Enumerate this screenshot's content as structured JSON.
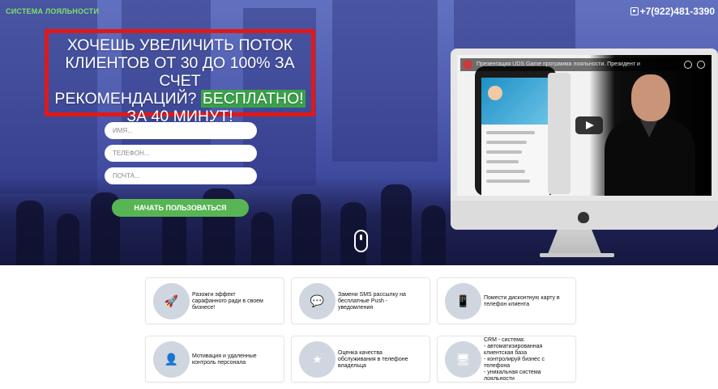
{
  "header": {
    "brand": "СИСТЕМА ЛОЯЛЬНОСТИ",
    "phone": "+7(922)481-3390"
  },
  "hero": {
    "headline_lines": [
      "ХОЧЕШЬ УВЕЛИЧИТЬ ПОТОК",
      "КЛИЕНТОВ ОТ 30 ДО 100% ЗА СЧЕТ",
      "РЕКОМЕНДАЦИЙ?"
    ],
    "headline_free": "БЕСПЛАТНО!",
    "headline_last": "ЗА 40 МИНУТ!",
    "form": {
      "name_placeholder": "ИМЯ...",
      "phone_placeholder": "ТЕЛЕФОН...",
      "email_placeholder": "ПОЧТА...",
      "submit_label": "НАЧАТЬ ПОЛЬЗОВАТЬСЯ"
    }
  },
  "video": {
    "title": "Презентация UDS Game программа лояльности. Президент и"
  },
  "features": [
    {
      "icon": "rocket-icon",
      "text": "Разожги эффект\nсарафанного ради в своем\nбизнесе!"
    },
    {
      "icon": "chat-bubble-icon",
      "text": "Замени SMS рассылку на\nбесплатные Push -\nуведомления"
    },
    {
      "icon": "mobile-cart-icon",
      "text": "Помести дисконтную карту в\nтелефон клиента"
    },
    {
      "icon": "staff-icon",
      "text": "Мотивация и удаленные\nконтроль персонала"
    },
    {
      "icon": "star-medal-icon",
      "text": "Оценка качества\nобслуживания в телефоне\nвладельца"
    },
    {
      "icon": "crm-screen-icon",
      "text": "CRM - система:\n- автоматизированная\nклиентская база\n- контролируй бизнес с\nтелефона\n- уникальная система\nлояльности"
    }
  ],
  "colors": {
    "accent_green": "#58b553",
    "brand_green": "#7ee26b",
    "headline_border": "#e21818",
    "hero_blue": "#5a67b4"
  }
}
